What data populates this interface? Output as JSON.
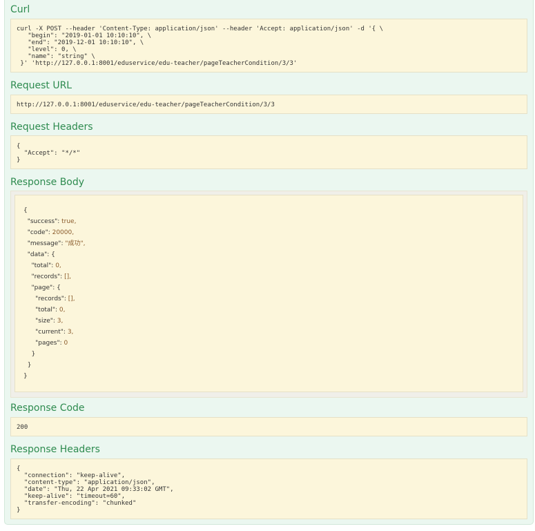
{
  "sections": {
    "curl": {
      "title": "Curl",
      "text": "curl -X POST --header 'Content-Type: application/json' --header 'Accept: application/json' -d '{ \\\n   \"begin\": \"2019-01-01 10:10:10\", \\\n   \"end\": \"2019-12-01 10:10:10\", \\\n   \"level\": 0, \\\n   \"name\": \"string\" \\\n }' 'http://127.0.0.1:8001/eduservice/edu-teacher/pageTeacherCondition/3/3'"
    },
    "request_url": {
      "title": "Request URL",
      "text": "http://127.0.0.1:8001/eduservice/edu-teacher/pageTeacherCondition/3/3"
    },
    "request_headers": {
      "title": "Request Headers",
      "text": "{\n  \"Accept\": \"*/*\"\n}"
    },
    "response_body": {
      "title": "Response Body",
      "lines": [
        {
          "key": "{",
          "val": ""
        },
        {
          "key": "  \"success\": ",
          "val": "true,"
        },
        {
          "key": "  \"code\": ",
          "val": "20000,"
        },
        {
          "key": "  \"message\": ",
          "val": "\"成功\","
        },
        {
          "key": "  \"data\": {",
          "val": ""
        },
        {
          "key": "    \"total\": ",
          "val": "0,"
        },
        {
          "key": "    \"records\": ",
          "val": "[],"
        },
        {
          "key": "    \"page\": {",
          "val": ""
        },
        {
          "key": "      \"records\": ",
          "val": "[],"
        },
        {
          "key": "      \"total\": ",
          "val": "0,"
        },
        {
          "key": "      \"size\": ",
          "val": "3,"
        },
        {
          "key": "      \"current\": ",
          "val": "3,"
        },
        {
          "key": "      \"pages\": ",
          "val": "0"
        },
        {
          "key": "    }",
          "val": ""
        },
        {
          "key": "  }",
          "val": ""
        },
        {
          "key": "}",
          "val": ""
        }
      ]
    },
    "response_code": {
      "title": "Response Code",
      "text": "200"
    },
    "response_headers": {
      "title": "Response Headers",
      "text": "{\n  \"connection\": \"keep-alive\",\n  \"content-type\": \"application/json\",\n  \"date\": \"Thu, 22 Apr 2021 09:33:02 GMT\",\n  \"keep-alive\": \"timeout=60\",\n  \"transfer-encoding\": \"chunked\"\n}"
    }
  }
}
